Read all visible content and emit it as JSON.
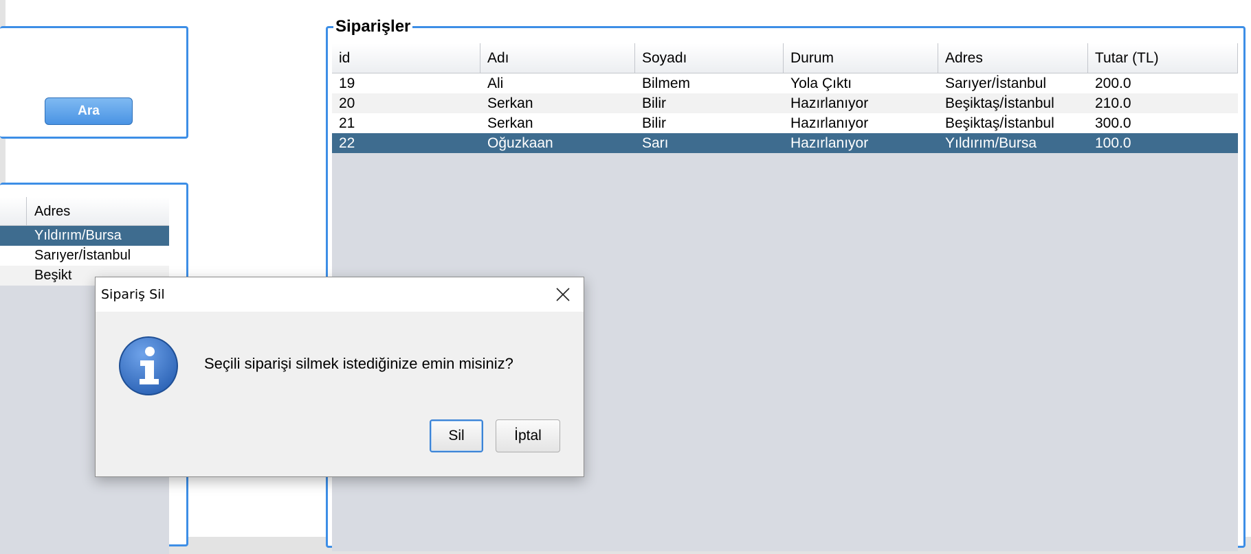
{
  "search_panel": {
    "search_button": "Ara"
  },
  "customers_panel": {
    "column_header": "Adres",
    "rows": [
      {
        "adres": "Yıldırım/Bursa",
        "selected": true
      },
      {
        "adres": "Sarıyer/İstanbul",
        "selected": false
      },
      {
        "adres": "Beşikt",
        "selected": false
      }
    ]
  },
  "orders_panel": {
    "title": "Siparişler",
    "columns": [
      "id",
      "Adı",
      "Soyadı",
      "Durum",
      "Adres",
      "Tutar (TL)"
    ],
    "rows": [
      {
        "id": "19",
        "adi": "Ali",
        "soyadi": "Bilmem",
        "durum": "Yola Çıktı",
        "adres": "Sarıyer/İstanbul",
        "tutar": "200.0",
        "selected": false
      },
      {
        "id": "20",
        "adi": "Serkan",
        "soyadi": "Bilir",
        "durum": "Hazırlanıyor",
        "adres": "Beşiktaş/İstanbul",
        "tutar": "210.0",
        "selected": false
      },
      {
        "id": "21",
        "adi": "Serkan",
        "soyadi": "Bilir",
        "durum": "Hazırlanıyor",
        "adres": "Beşiktaş/İstanbul",
        "tutar": "300.0",
        "selected": false
      },
      {
        "id": "22",
        "adi": "Oğuzkaan",
        "soyadi": "Sarı",
        "durum": "Hazırlanıyor",
        "adres": "Yıldırım/Bursa",
        "tutar": "100.0",
        "selected": true
      }
    ]
  },
  "dialog": {
    "title": "Sipariş Sil",
    "message": "Seçili siparişi silmek istediğinize emin misiniz?",
    "confirm_label": "Sil",
    "cancel_label": "İptal",
    "icon": "info-icon",
    "close_icon": "close-icon"
  },
  "colors": {
    "accent_border": "#3d8ee6",
    "selection": "#3e6c8f",
    "table_background": "#d8dbe2",
    "info_icon": "#2f66b8"
  }
}
